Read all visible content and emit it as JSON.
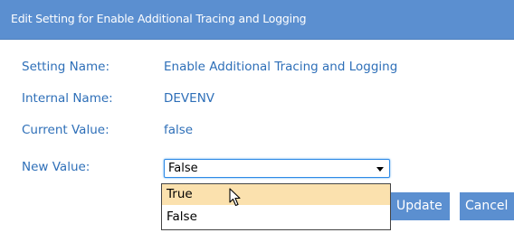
{
  "dialog": {
    "title": "Edit Setting for Enable Additional Tracing and Logging"
  },
  "fields": {
    "setting_name_label": "Setting Name:",
    "setting_name_value": "Enable Additional Tracing and Logging",
    "internal_name_label": "Internal Name:",
    "internal_name_value": "DEVENV",
    "current_value_label": "Current Value:",
    "current_value_value": "false",
    "new_value_label": "New Value:"
  },
  "select": {
    "selected": "False",
    "options": [
      "True",
      "False"
    ],
    "highlighted_option": "True"
  },
  "buttons": {
    "update_label": "Update",
    "cancel_label": "Cancel"
  },
  "colors": {
    "titlebar": "#5b8fd0",
    "label_text": "#2e6fb8",
    "hover_option": "#fbe1ae",
    "button": "#5b8fd0"
  },
  "icons": {
    "pointer": "mouse-pointer-icon",
    "dropdown_caret": "chevron-down-icon"
  }
}
